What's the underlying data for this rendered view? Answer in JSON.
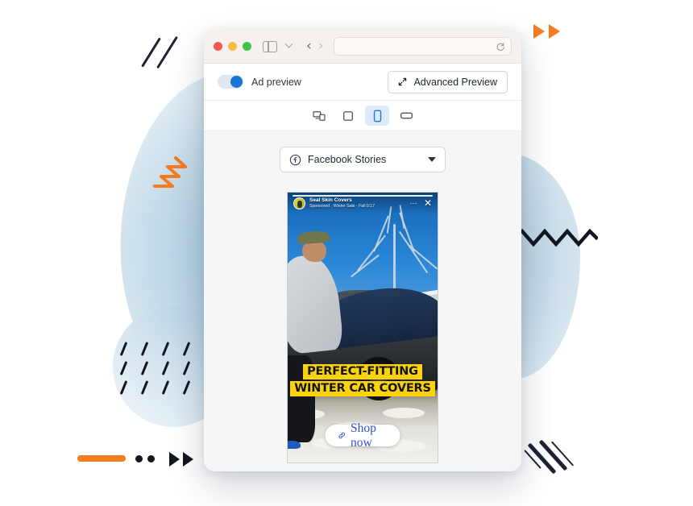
{
  "window": {
    "traffic_lights": [
      "close",
      "minimize",
      "maximize"
    ],
    "sidebar_icon": "sidebar-toggle-icon",
    "tab_overview_icon": "chevron-down-icon",
    "back_label": "‹",
    "forward_label": "›",
    "url_value": "",
    "url_placeholder": "",
    "reload_icon": "reload-icon"
  },
  "toolbar": {
    "toggle_label": "Ad preview",
    "toggle_state": "on",
    "advanced_button_label": "Advanced Preview",
    "advanced_button_icon": "expand-diagonal-icon"
  },
  "devices": [
    {
      "name": "all-devices",
      "icon": "multi-screen-icon",
      "active": false
    },
    {
      "name": "tablet",
      "icon": "tablet-icon",
      "active": false
    },
    {
      "name": "mobile-portrait",
      "icon": "phone-portrait-icon",
      "active": true
    },
    {
      "name": "mobile-landscape",
      "icon": "phone-landscape-icon",
      "active": false
    }
  ],
  "preview": {
    "platform_label": "Facebook Stories",
    "platform_icon": "facebook-icon",
    "caret_icon": "chevron-down-icon"
  },
  "ad": {
    "advertiser": "Seal Skin Covers",
    "meta": "Sponsored · Winter Sale · Fall 9:17",
    "more_icon": "more-options-icon",
    "close_icon": "close-icon",
    "headline_line1": "PERFECT-FITTING",
    "headline_line2": "WINTER CAR COVERS",
    "cta_label": "Shop now",
    "cta_icon": "link-icon",
    "highlight_color": "#fcd309",
    "cta_text_color": "#2f52c8"
  },
  "decor": {
    "blob_color": "#a9c9de",
    "orange": "#f57c1f",
    "dark": "#12161f"
  }
}
